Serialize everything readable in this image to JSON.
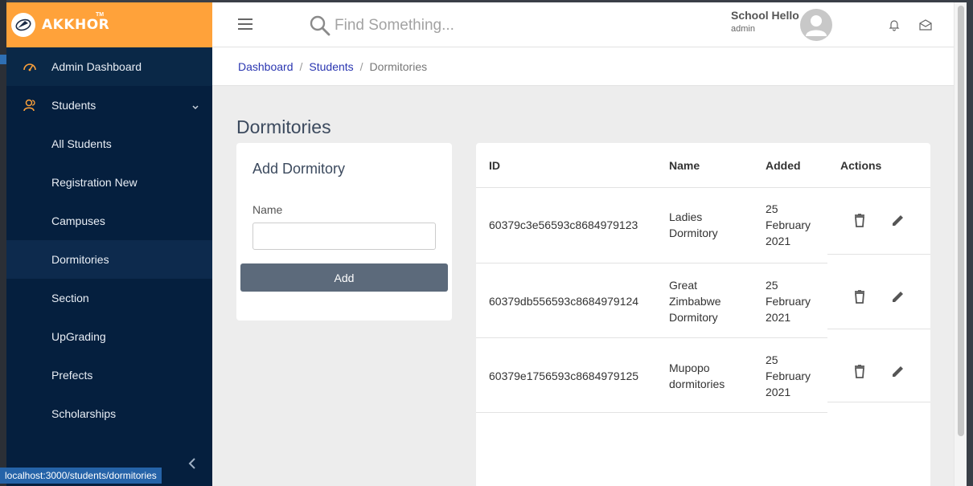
{
  "brand": {
    "name": "AKKHOR",
    "tm": "TM"
  },
  "sidebar": {
    "items": [
      {
        "label": "Admin Dashboard",
        "icon": "dashboard-icon"
      },
      {
        "label": "Students",
        "icon": "students-icon",
        "expanded": true
      }
    ],
    "subitems": [
      {
        "label": "All Students"
      },
      {
        "label": "Registration New"
      },
      {
        "label": "Campuses"
      },
      {
        "label": "Dormitories",
        "active": true
      },
      {
        "label": "Section"
      },
      {
        "label": "UpGrading"
      },
      {
        "label": "Prefects"
      },
      {
        "label": "Scholarships"
      }
    ]
  },
  "header": {
    "search_placeholder": "Find Something...",
    "user_name": "School Hello",
    "user_role": "admin"
  },
  "breadcrumb": {
    "items": [
      "Dashboard",
      "Students"
    ],
    "current": "Dormitories"
  },
  "page": {
    "title": "Dormitories"
  },
  "form": {
    "title": "Add Dormitory",
    "name_label": "Name",
    "name_value": "",
    "submit_label": "Add"
  },
  "table": {
    "columns": [
      "ID",
      "Name",
      "Added",
      "Actions"
    ],
    "rows": [
      {
        "id": "60379c3e56593c8684979123",
        "name_lines": [
          "Ladies",
          "Dormitory"
        ],
        "added_lines": [
          "25",
          "February",
          "2021"
        ]
      },
      {
        "id": "60379db556593c8684979124",
        "name_lines": [
          "Great",
          "Zimbabwe",
          "Dormitory"
        ],
        "added_lines": [
          "25",
          "February",
          "2021"
        ]
      },
      {
        "id": "60379e1756593c8684979125",
        "name_lines": [
          "Mupopo",
          "dormitories"
        ],
        "added_lines": [
          "25",
          "February",
          "2021"
        ]
      }
    ]
  },
  "statusbar": {
    "url": "localhost:3000/students/dormitories"
  },
  "colors": {
    "brand": "#ffa23a",
    "sidebar": "#051f3e",
    "button": "#5c6a7b",
    "link": "#2a36b1"
  }
}
